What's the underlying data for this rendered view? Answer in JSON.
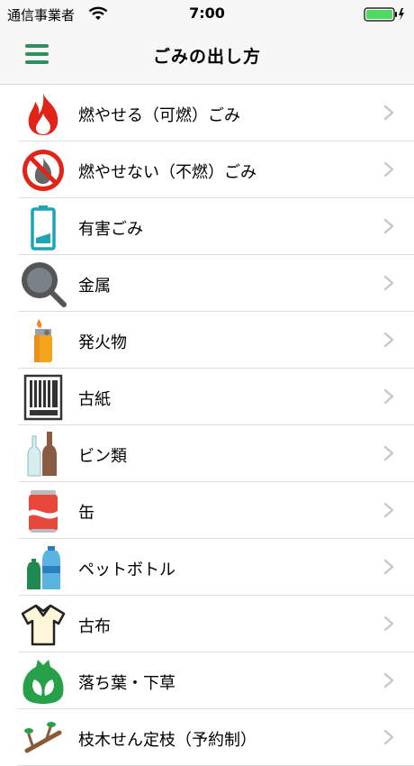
{
  "status": {
    "carrier": "通信事業者",
    "time": "7:00"
  },
  "header": {
    "title": "ごみの出し方"
  },
  "categories": [
    {
      "label": "燃やせる（可燃）ごみ",
      "icon": "flame-icon"
    },
    {
      "label": "燃やせない（不燃）ごみ",
      "icon": "no-burn-icon"
    },
    {
      "label": "有害ごみ",
      "icon": "battery-icon"
    },
    {
      "label": "金属",
      "icon": "frying-pan-icon"
    },
    {
      "label": "発火物",
      "icon": "lighter-icon"
    },
    {
      "label": "古紙",
      "icon": "newspaper-icon"
    },
    {
      "label": "ビン類",
      "icon": "bottles-icon"
    },
    {
      "label": "缶",
      "icon": "can-icon"
    },
    {
      "label": "ペットボトル",
      "icon": "pet-bottle-icon"
    },
    {
      "label": "古布",
      "icon": "shirt-icon"
    },
    {
      "label": "落ち葉・下草",
      "icon": "leaf-bag-icon"
    },
    {
      "label": "枝木せん定枝（予約制）",
      "icon": "branches-icon"
    }
  ],
  "colors": {
    "accent": "#2e8f5e",
    "bar": "#f7f7f7",
    "chevron": "#c7c7cc"
  }
}
